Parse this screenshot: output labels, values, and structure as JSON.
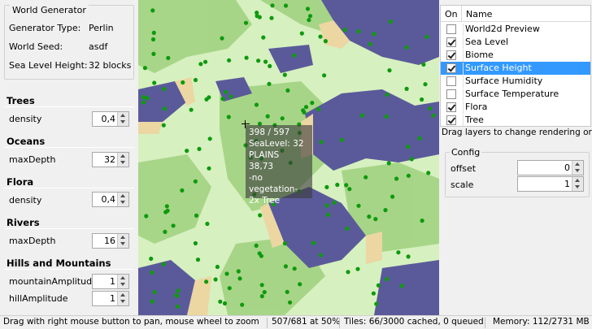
{
  "world_generator": {
    "title": "World Generator",
    "rows": [
      {
        "label": "Generator Type:",
        "value": "Perlin"
      },
      {
        "label": "World Seed:",
        "value": "asdf"
      },
      {
        "label": "Sea Level Height:",
        "value": "32 blocks"
      }
    ]
  },
  "params": {
    "trees": {
      "title": "Trees",
      "label": "density",
      "value": "0,4"
    },
    "oceans": {
      "title": "Oceans",
      "label": "maxDepth",
      "value": "32"
    },
    "flora": {
      "title": "Flora",
      "label": "density",
      "value": "0,4"
    },
    "rivers": {
      "title": "Rivers",
      "label": "maxDepth",
      "value": "16"
    },
    "hills": {
      "title": "Hills and Mountains",
      "label1": "mountainAmplitude",
      "value1": "1",
      "label2": "hillAmplitude",
      "value2": "1"
    }
  },
  "tooltip": [
    "398 / 597",
    "SeaLevel: 32",
    "PLAINS",
    "38,73",
    "-no vegetation-",
    "2x Tree"
  ],
  "layers": {
    "col_on": "On",
    "col_name": "Name",
    "items": [
      {
        "name": "World2d Preview",
        "checked": false
      },
      {
        "name": "Sea Level",
        "checked": true
      },
      {
        "name": "Biome",
        "checked": true
      },
      {
        "name": "Surface Height",
        "checked": true
      },
      {
        "name": "Surface Humidity",
        "checked": false
      },
      {
        "name": "Surface Temperature",
        "checked": false
      },
      {
        "name": "Flora",
        "checked": true
      },
      {
        "name": "Tree",
        "checked": true
      }
    ],
    "selected_index": 3,
    "hint": "Drag layers to change rendering order"
  },
  "config": {
    "title": "Config",
    "offset_label": "offset",
    "offset_value": "0",
    "scale_label": "scale",
    "scale_value": "1"
  },
  "status": {
    "hint": "Drag with right mouse button to pan, mouse wheel to zoom",
    "zoom": "507/681 at 50%",
    "tiles": "Tiles: 66/3000 cached, 0 queued",
    "memory": "Memory: 112/2731 MB"
  },
  "colors": {
    "land": "#d7f0c0",
    "grass": "#9fd17e",
    "water": "#5a5a9a",
    "sand": "#ecd6a2",
    "tree": "#0e9a0e",
    "selection": "#3399ff"
  }
}
